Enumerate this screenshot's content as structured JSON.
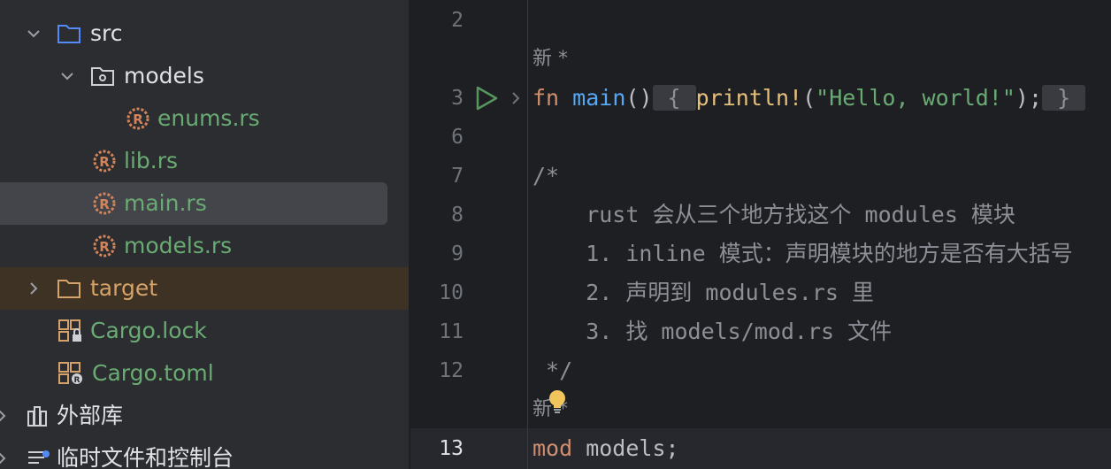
{
  "project_tree": {
    "items": [
      {
        "label": "src",
        "icon": "folder-icon",
        "expanded": true
      },
      {
        "label": "models",
        "icon": "module-folder-icon",
        "expanded": true
      },
      {
        "label": "enums.rs",
        "icon": "rust-file-icon"
      },
      {
        "label": "lib.rs",
        "icon": "rust-file-icon"
      },
      {
        "label": "main.rs",
        "icon": "rust-file-icon",
        "selected": true
      },
      {
        "label": "models.rs",
        "icon": "rust-file-icon"
      },
      {
        "label": "target",
        "icon": "folder-icon",
        "expanded": false,
        "excluded": true
      },
      {
        "label": "Cargo.lock",
        "icon": "cargo-lock-icon"
      },
      {
        "label": "Cargo.toml",
        "icon": "cargo-toml-icon"
      },
      {
        "label": "外部库",
        "icon": "library-icon",
        "expanded": false
      },
      {
        "label": "临时文件和控制台",
        "icon": "scratches-icon",
        "expanded": false
      }
    ]
  },
  "editor": {
    "lines": [
      {
        "number": "2",
        "text": ""
      },
      {
        "inlay": "新 *"
      },
      {
        "number": "3",
        "parts": [
          {
            "t": "fn",
            "c": "kw"
          },
          {
            "t": " "
          },
          {
            "t": "main",
            "c": "fn"
          },
          {
            "t": "()"
          },
          {
            "t": " { ",
            "c": "fold"
          },
          {
            "t": "println!",
            "c": "mac"
          },
          {
            "t": "("
          },
          {
            "t": "\"Hello, world!\"",
            "c": "str"
          },
          {
            "t": ");"
          },
          {
            "t": " } ",
            "c": "fold"
          }
        ]
      },
      {
        "number": "6",
        "text": ""
      },
      {
        "number": "7",
        "text": "/*"
      },
      {
        "number": "8",
        "text": "    rust 会从三个地方找这个 modules 模块"
      },
      {
        "number": "9",
        "text": "    1. inline 模式：声明模块的地方是否有大括号"
      },
      {
        "number": "10",
        "text": "    2. 声明到 modules.rs 里"
      },
      {
        "number": "11",
        "text": "    3. 找 models/mod.rs 文件"
      },
      {
        "number": "12",
        "text": " */"
      },
      {
        "inlay": "新 *"
      },
      {
        "number": "13",
        "parts": [
          {
            "t": "mod",
            "c": "kw"
          },
          {
            "t": " models;"
          }
        ]
      }
    ],
    "current_line": "13"
  },
  "colors": {
    "sidebar_bg": "#2b2d30",
    "editor_bg": "#1e1f22",
    "selection": "#43454a",
    "excluded_bg": "#3d3223",
    "keyword": "#cf8e6d",
    "function": "#56a8f5",
    "macro": "#e6c07b",
    "string": "#6aab73",
    "comment": "#8c8f96"
  }
}
